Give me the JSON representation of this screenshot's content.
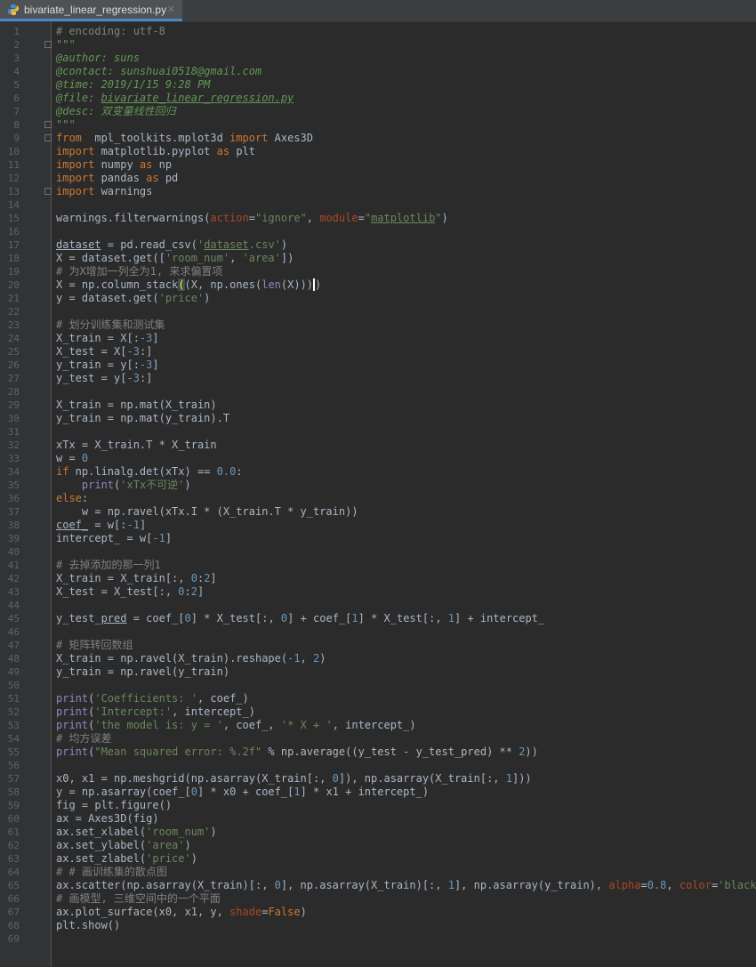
{
  "tab": {
    "filename": "bivariate_linear_regression.py",
    "close": "✕"
  },
  "lines": [
    [
      [
        "c",
        "# encoding: utf-8"
      ]
    ],
    [
      [
        "d",
        "\"\"\""
      ]
    ],
    [
      [
        "d",
        "@author: suns"
      ]
    ],
    [
      [
        "d",
        "@contact: sunshuai0518@gmail.com"
      ]
    ],
    [
      [
        "d",
        "@time: 2019/1/15 9:28 PM"
      ]
    ],
    [
      [
        "d",
        "@file: "
      ],
      [
        "du",
        "bivariate_linear_regression.py"
      ]
    ],
    [
      [
        "d",
        "@desc: 双变量线性回归"
      ]
    ],
    [
      [
        "d",
        "\"\"\""
      ]
    ],
    [
      [
        "k",
        "from"
      ],
      [
        "",
        "  mpl_toolkits.mplot3d "
      ],
      [
        "k",
        "import"
      ],
      [
        "",
        " Axes3D"
      ]
    ],
    [
      [
        "k",
        "import"
      ],
      [
        "",
        " matplotlib.pyplot "
      ],
      [
        "k",
        "as"
      ],
      [
        "",
        " plt"
      ]
    ],
    [
      [
        "k",
        "import"
      ],
      [
        "",
        " numpy "
      ],
      [
        "k",
        "as"
      ],
      [
        "",
        " np"
      ]
    ],
    [
      [
        "k",
        "import"
      ],
      [
        "",
        " pandas "
      ],
      [
        "k",
        "as"
      ],
      [
        "",
        " pd"
      ]
    ],
    [
      [
        "k",
        "import"
      ],
      [
        "",
        " warnings"
      ]
    ],
    [],
    [
      [
        "",
        "warnings.filterwarnings("
      ],
      [
        "p",
        "action"
      ],
      [
        "",
        "="
      ],
      [
        "s",
        "\"ignore\""
      ],
      [
        "",
        ", "
      ],
      [
        "p",
        "module"
      ],
      [
        "",
        "="
      ],
      [
        "s",
        "\""
      ],
      [
        "su",
        "matplotlib"
      ],
      [
        "s",
        "\""
      ],
      [
        "",
        ")"
      ]
    ],
    [],
    [
      [
        "u",
        "dataset"
      ],
      [
        "",
        " = pd.read_csv("
      ],
      [
        "s",
        "'"
      ],
      [
        "su",
        "dataset"
      ],
      [
        "s",
        ".csv'"
      ],
      [
        "",
        ")"
      ]
    ],
    [
      [
        "",
        "X = dataset.get(["
      ],
      [
        "s",
        "'room_num'"
      ],
      [
        "",
        ", "
      ],
      [
        "s",
        "'area'"
      ],
      [
        "",
        "])"
      ]
    ],
    [
      [
        "c",
        "# 为X增加一列全为1, 来求偏置项"
      ]
    ],
    [
      [
        "",
        "X = np.column_stack"
      ],
      [
        "bm",
        "("
      ],
      [
        "",
        "(X, np.ones("
      ],
      [
        "b",
        "len"
      ],
      [
        "",
        "(X)))"
      ],
      [
        "cur",
        ")"
      ]
    ],
    [
      [
        "",
        "y = dataset.get("
      ],
      [
        "s",
        "'price'"
      ],
      [
        "",
        ")"
      ]
    ],
    [],
    [
      [
        "c",
        "# 划分训练集和测试集"
      ]
    ],
    [
      [
        "",
        "X_train = X[:"
      ],
      [
        "n",
        "-3"
      ],
      [
        "",
        "]"
      ]
    ],
    [
      [
        "",
        "X_test = X["
      ],
      [
        "n",
        "-3"
      ],
      [
        "",
        ":]"
      ]
    ],
    [
      [
        "",
        "y_train = y[:"
      ],
      [
        "n",
        "-3"
      ],
      [
        "",
        "]"
      ]
    ],
    [
      [
        "",
        "y_test = y["
      ],
      [
        "n",
        "-3"
      ],
      [
        "",
        ":]"
      ]
    ],
    [],
    [
      [
        "",
        "X_train = np.mat(X_train)"
      ]
    ],
    [
      [
        "",
        "y_train = np.mat(y_train).T"
      ]
    ],
    [],
    [
      [
        "",
        "xTx = X_train.T * X_train"
      ]
    ],
    [
      [
        "",
        "w = "
      ],
      [
        "n",
        "0"
      ]
    ],
    [
      [
        "k",
        "if"
      ],
      [
        "",
        " np.linalg.det(xTx) == "
      ],
      [
        "n",
        "0.0"
      ],
      [
        "",
        ":"
      ]
    ],
    [
      [
        "",
        "    "
      ],
      [
        "b",
        "print"
      ],
      [
        "",
        "("
      ],
      [
        "s",
        "'xTx不可逆'"
      ],
      [
        "",
        ")"
      ]
    ],
    [
      [
        "k",
        "else"
      ],
      [
        "",
        ":"
      ]
    ],
    [
      [
        "",
        "    w = np.ravel(xTx.I * (X_train.T * y_train))"
      ]
    ],
    [
      [
        "u",
        "coef_"
      ],
      [
        "",
        " = w[:"
      ],
      [
        "n",
        "-1"
      ],
      [
        "",
        "]"
      ]
    ],
    [
      [
        "",
        "intercept_ = w["
      ],
      [
        "n",
        "-1"
      ],
      [
        "",
        "]"
      ]
    ],
    [],
    [
      [
        "c",
        "# 去掉添加的那一列1"
      ]
    ],
    [
      [
        "",
        "X_train = X_train[:, "
      ],
      [
        "n",
        "0"
      ],
      [
        "",
        ":"
      ],
      [
        "n",
        "2"
      ],
      [
        "",
        "]"
      ]
    ],
    [
      [
        "",
        "X_test = X_test[:, "
      ],
      [
        "n",
        "0"
      ],
      [
        "",
        ":"
      ],
      [
        "n",
        "2"
      ],
      [
        "",
        "]"
      ]
    ],
    [],
    [
      [
        "",
        "y_test_"
      ],
      [
        "u",
        "pred"
      ],
      [
        "",
        " = coef_["
      ],
      [
        "n",
        "0"
      ],
      [
        "",
        "] * X_test[:, "
      ],
      [
        "n",
        "0"
      ],
      [
        "",
        "] + coef_["
      ],
      [
        "n",
        "1"
      ],
      [
        "",
        "] * X_test[:, "
      ],
      [
        "n",
        "1"
      ],
      [
        "",
        "] + intercept_"
      ]
    ],
    [],
    [
      [
        "c",
        "# 矩阵转回数组"
      ]
    ],
    [
      [
        "",
        "X_train = np.ravel(X_train).reshape("
      ],
      [
        "n",
        "-1"
      ],
      [
        "",
        ", "
      ],
      [
        "n",
        "2"
      ],
      [
        "",
        ")"
      ]
    ],
    [
      [
        "",
        "y_train = np.ravel(y_train)"
      ]
    ],
    [],
    [
      [
        "b",
        "print"
      ],
      [
        "",
        "("
      ],
      [
        "s",
        "'Coefficients: '"
      ],
      [
        "",
        ", coef_)"
      ]
    ],
    [
      [
        "b",
        "print"
      ],
      [
        "",
        "("
      ],
      [
        "s",
        "'Intercept:'"
      ],
      [
        "",
        ", intercept_)"
      ]
    ],
    [
      [
        "b",
        "print"
      ],
      [
        "",
        "("
      ],
      [
        "s",
        "'the model is: y = '"
      ],
      [
        "",
        ", coef_, "
      ],
      [
        "s",
        "'* X + '"
      ],
      [
        "",
        ", intercept_)"
      ]
    ],
    [
      [
        "c",
        "# 均方误差"
      ]
    ],
    [
      [
        "b",
        "print"
      ],
      [
        "",
        "("
      ],
      [
        "s",
        "\"Mean squared error: %.2f\""
      ],
      [
        "",
        " % np.average((y_test - y_test_pred) ** "
      ],
      [
        "n",
        "2"
      ],
      [
        "",
        "))"
      ]
    ],
    [],
    [
      [
        "",
        "x0, x1 = np.meshgrid(np.asarray(X_train[:, "
      ],
      [
        "n",
        "0"
      ],
      [
        "",
        "]), np.asarray(X_train[:, "
      ],
      [
        "n",
        "1"
      ],
      [
        "",
        "]))"
      ]
    ],
    [
      [
        "",
        "y = np.asarray(coef_["
      ],
      [
        "n",
        "0"
      ],
      [
        "",
        "] * x0 + coef_["
      ],
      [
        "n",
        "1"
      ],
      [
        "",
        "] * x1 + intercept_)"
      ]
    ],
    [
      [
        "",
        "fig = plt.figure()"
      ]
    ],
    [
      [
        "",
        "ax = Axes3D(fig)"
      ]
    ],
    [
      [
        "",
        "ax.set_xlabel("
      ],
      [
        "s",
        "'room_num'"
      ],
      [
        "",
        ")"
      ]
    ],
    [
      [
        "",
        "ax.set_ylabel("
      ],
      [
        "s",
        "'area'"
      ],
      [
        "",
        ")"
      ]
    ],
    [
      [
        "",
        "ax.set_zlabel("
      ],
      [
        "s",
        "'price'"
      ],
      [
        "",
        ")"
      ]
    ],
    [
      [
        "c",
        "# # 画训练集的散点图"
      ]
    ],
    [
      [
        "",
        "ax.scatter(np.asarray(X_train)[:, "
      ],
      [
        "n",
        "0"
      ],
      [
        "",
        "], np.asarray(X_train)[:, "
      ],
      [
        "n",
        "1"
      ],
      [
        "",
        "], np.asarray(y_train), "
      ],
      [
        "p",
        "alpha"
      ],
      [
        "",
        "="
      ],
      [
        "n",
        "0.8"
      ],
      [
        "",
        ", "
      ],
      [
        "p",
        "color"
      ],
      [
        "",
        "="
      ],
      [
        "s",
        "'black'"
      ],
      [
        "",
        ")"
      ]
    ],
    [
      [
        "c",
        "# 画模型, 三维空间中的一个平面"
      ]
    ],
    [
      [
        "",
        "ax.plot_surface(x0, x1, y, "
      ],
      [
        "p",
        "shade"
      ],
      [
        "",
        "="
      ],
      [
        "k",
        "False"
      ],
      [
        "",
        ")"
      ]
    ],
    [
      [
        "",
        "plt.show()"
      ]
    ],
    []
  ]
}
